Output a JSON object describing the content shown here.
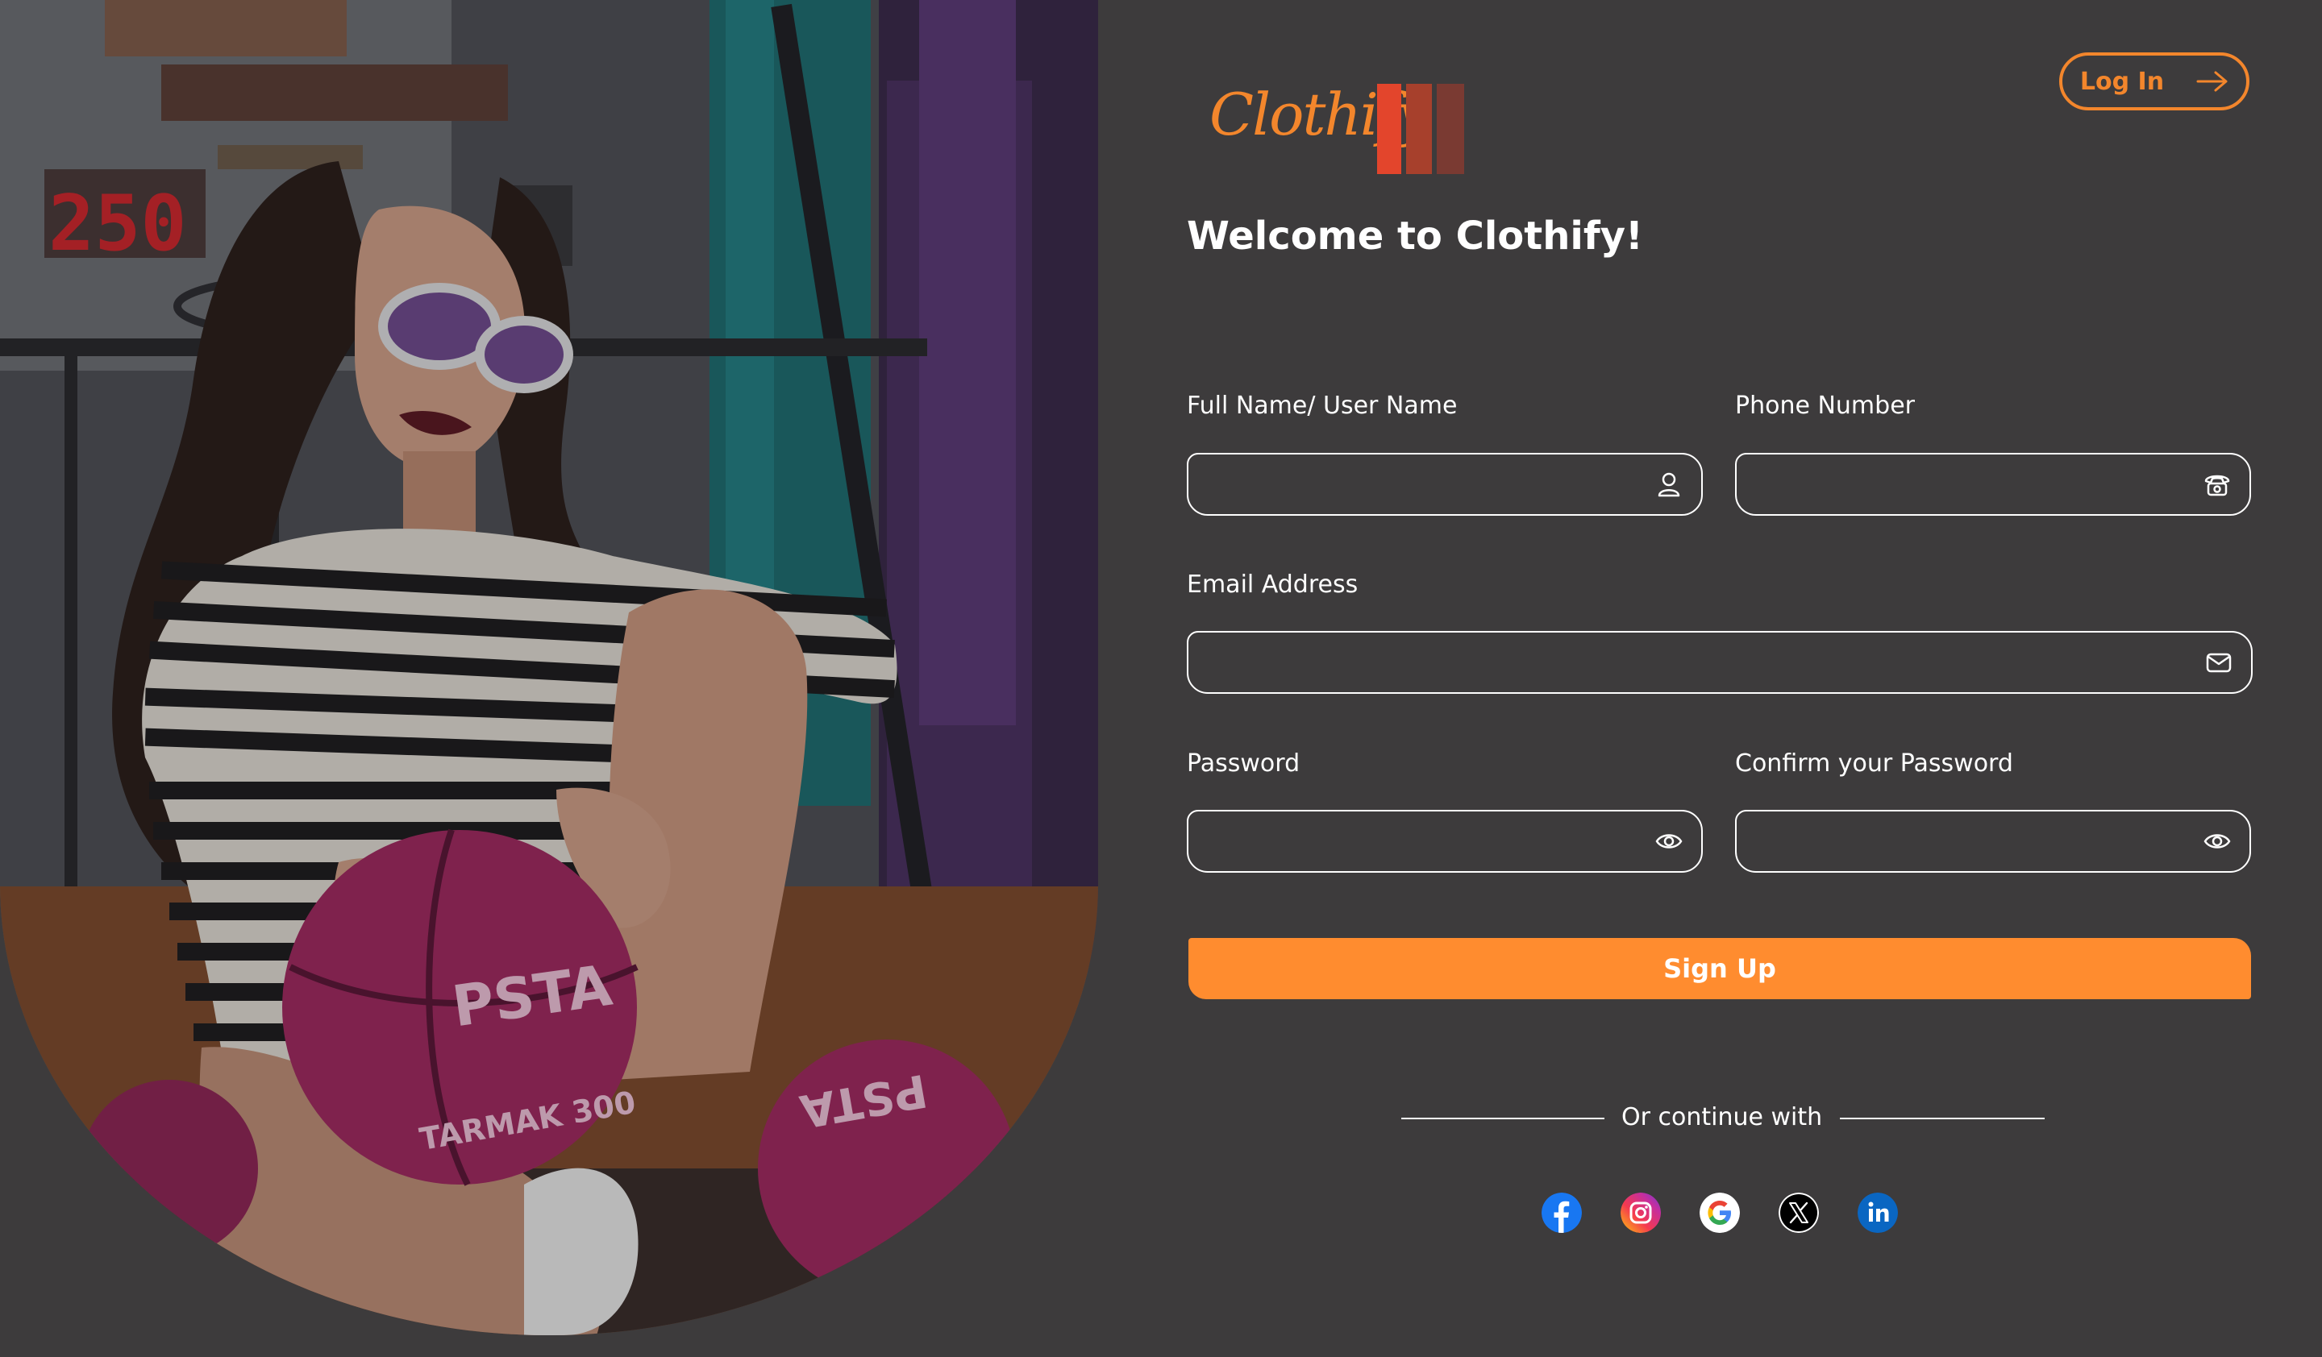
{
  "brand": {
    "name": "Clothify",
    "accent": "#f3862c",
    "bar_colors": [
      "#e3452c",
      "#a7402c",
      "#7a3a32"
    ]
  },
  "header": {
    "login_label": "Log In",
    "login_icon": "arrow-right-icon"
  },
  "title": "Welcome to Clothify!",
  "form": {
    "full_name_label": "Full Name/ User Name",
    "full_name_value": "",
    "full_name_icon": "user-icon",
    "phone_label": "Phone Number",
    "phone_value": "",
    "phone_icon": "phone-icon",
    "email_label": "Email Address",
    "email_value": "",
    "email_icon": "mail-icon",
    "password_label": "Password",
    "password_value": "",
    "password_icon": "eye-icon",
    "confirm_label": "Confirm your Password",
    "confirm_value": "",
    "confirm_icon": "eye-icon",
    "submit_label": "Sign Up"
  },
  "alt_login": {
    "label": "Or continue with",
    "providers": [
      "facebook-icon",
      "instagram-icon",
      "google-icon",
      "x-icon",
      "linkedin-icon"
    ]
  },
  "photo": {
    "ball_print_1": "PSTA",
    "ball_print_2": "TARMAK 300",
    "ball_print_3": "PSTA",
    "scoreboard": "250"
  }
}
